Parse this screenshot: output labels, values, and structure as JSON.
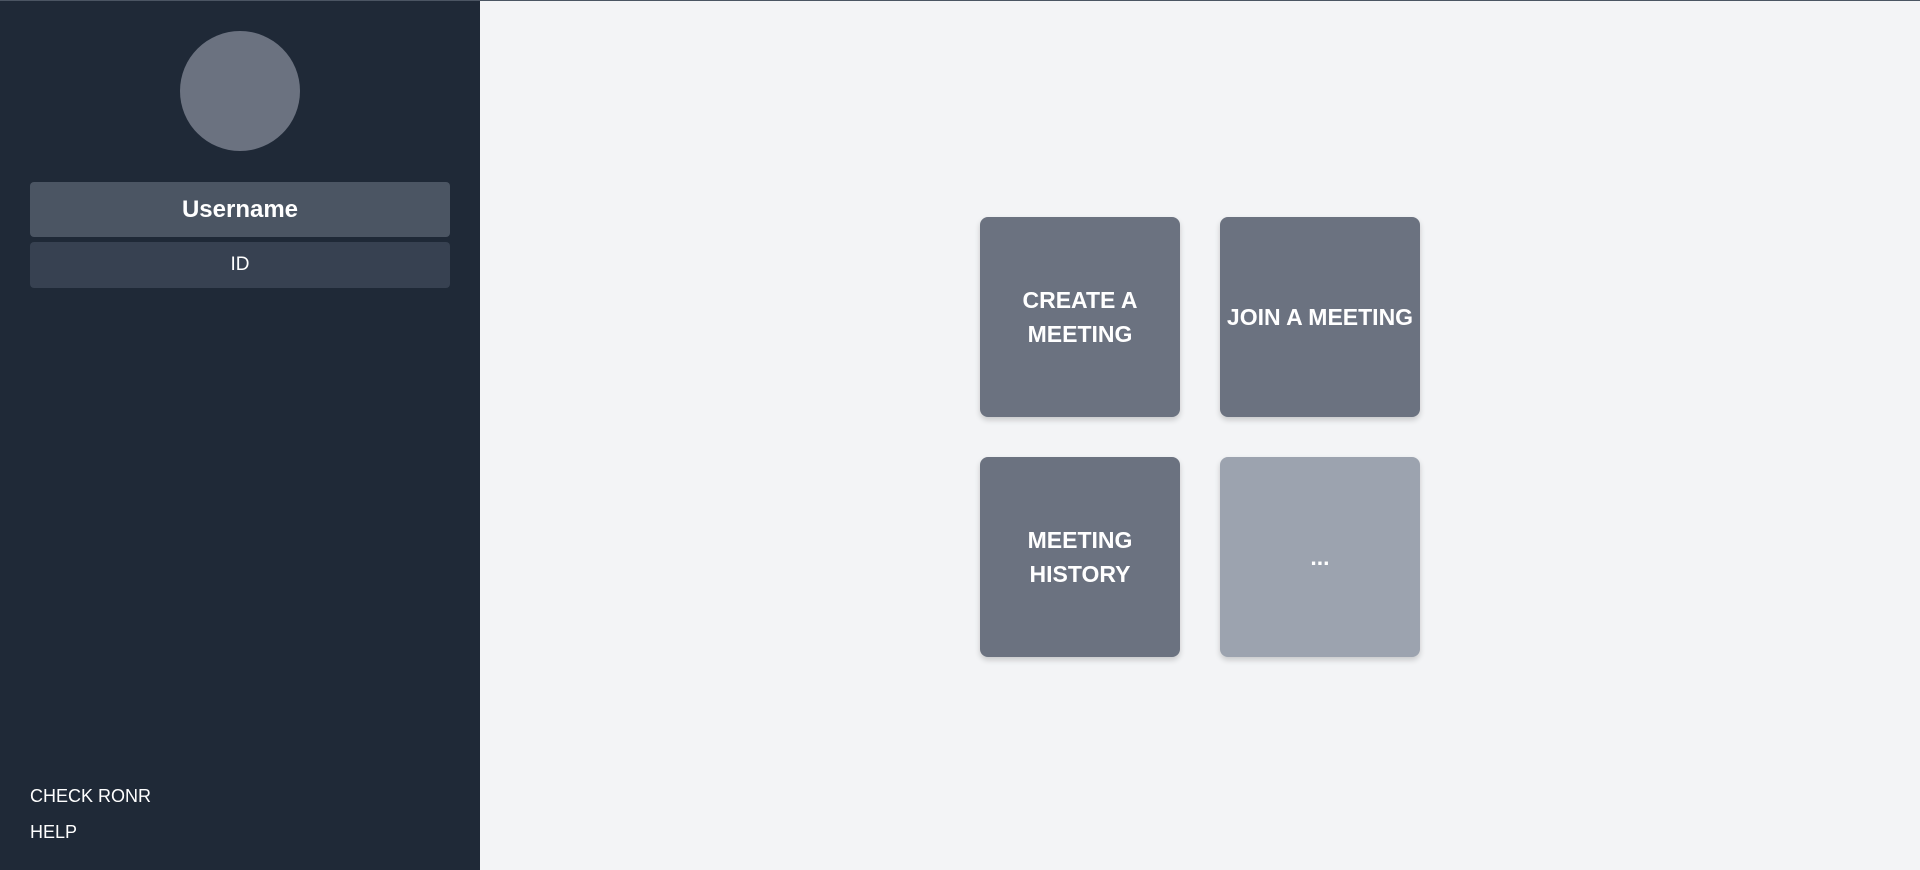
{
  "sidebar": {
    "username": "Username",
    "user_id": "ID",
    "links": [
      {
        "label": "CHECK RONR"
      },
      {
        "label": "HELP"
      }
    ]
  },
  "main": {
    "tiles": [
      {
        "label": "CREATE A MEETING"
      },
      {
        "label": "JOIN A MEETING"
      },
      {
        "label": "MEETING HISTORY"
      },
      {
        "label": "..."
      }
    ]
  },
  "colors": {
    "sidebar_bg": "#1f2937",
    "main_bg": "#f3f4f6",
    "avatar": "#6b7280",
    "username_bg": "#4b5563",
    "id_bg": "#374151",
    "tile": "#6b7280",
    "tile_light": "#9ca3af"
  }
}
